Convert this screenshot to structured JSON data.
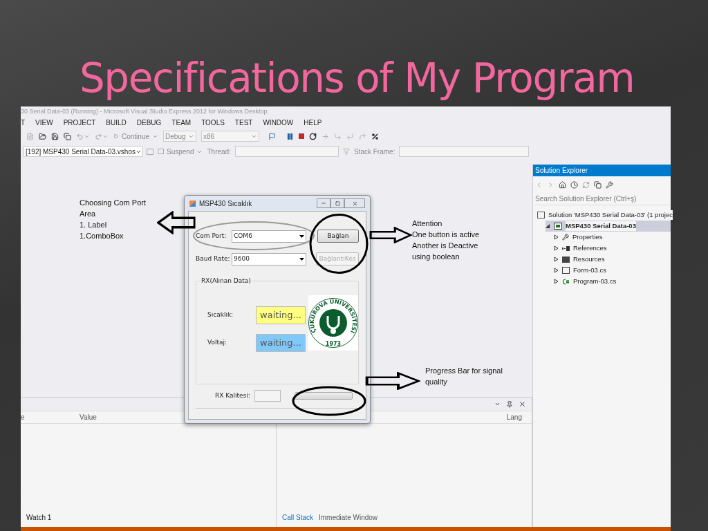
{
  "slide": {
    "title": "Specifications of My Program"
  },
  "ide": {
    "title_bar": "30 Serial Data-03 (Running) - Microsoft Visual Studio Express 2012 for Windows Desktop",
    "menu": [
      "T",
      "VIEW",
      "PROJECT",
      "BUILD",
      "DEBUG",
      "TEAM",
      "TOOLS",
      "TEST",
      "WINDOW",
      "HELP"
    ],
    "toolbar": {
      "continue": "Continue",
      "configuration": "Debug",
      "platform": "x86"
    },
    "debug_location": {
      "process": "[192] MSP430 Serial Data-03.vshos",
      "suspend": "Suspend",
      "thread_label": "Thread:",
      "stack_frame_label": "Stack Frame:"
    },
    "solution_explorer": {
      "title": "Solution Explorer",
      "search": {
        "placeholder": "Search Solution Explorer (Ctrl+ş)"
      },
      "tree": [
        {
          "label": "Solution 'MSP430 Serial Data-03' (1 projec",
          "kind": "solution",
          "selected": false,
          "children": [
            {
              "label": "MSP430 Serial Data-03",
              "kind": "project",
              "selected": true,
              "expanded": true,
              "children": [
                {
                  "label": "Properties",
                  "kind": "properties",
                  "selected": false,
                  "expanded": false
                },
                {
                  "label": "References",
                  "kind": "references",
                  "selected": false,
                  "expanded": false
                },
                {
                  "label": "Resources",
                  "kind": "folder",
                  "selected": false,
                  "expanded": false
                },
                {
                  "label": "Form-03.cs",
                  "kind": "form",
                  "selected": false,
                  "expanded": false
                },
                {
                  "label": "Program-03.cs",
                  "kind": "code",
                  "selected": false,
                  "expanded": false
                }
              ]
            }
          ]
        }
      ]
    },
    "watch_panel": {
      "columns": [
        "e",
        "Value"
      ],
      "tabs": [
        {
          "label": "Watch 1",
          "selected": true
        }
      ]
    },
    "call_stack_panel": {
      "columns": [
        "Lang"
      ],
      "tabs": [
        {
          "label": "Call Stack",
          "selected": true
        },
        {
          "label": "Immediate Window",
          "selected": false
        }
      ]
    }
  },
  "dialog": {
    "title": "MSP430 Sıcaklık",
    "com_port": {
      "label": "Com Port:",
      "value": "COM6"
    },
    "baud_rate": {
      "label": "Baud Rate:",
      "value": "9600"
    },
    "buttons": [
      {
        "label": "Bağlan",
        "disabled": false
      },
      {
        "label": "BağlantıKes",
        "disabled": true
      }
    ],
    "group": {
      "title": "RX(Alınan Data)"
    },
    "readings": [
      {
        "label": "Sıcaklık:",
        "value": "waiting...",
        "color": "#ffff80"
      },
      {
        "label": "Voltaj:",
        "value": "waiting...",
        "color": "#80c8f8"
      }
    ],
    "logo": {
      "ring_text": "ÇUKUROVA ÜNİVERSİTESİ",
      "year": "1973"
    },
    "rx_quality": {
      "label": "RX Kalitesi:",
      "level": 0
    }
  },
  "annotations": [
    {
      "kind": "left",
      "lines": [
        "Choosing Com Port",
        "Area",
        "1. Label",
        "1.ComboBox"
      ]
    },
    {
      "kind": "right",
      "lines": [
        "Attention",
        "One button is active",
        "Another is Deactive",
        "using boolean"
      ]
    },
    {
      "kind": "bottom",
      "lines": [
        "Progress Bar for signal quality"
      ]
    }
  ]
}
